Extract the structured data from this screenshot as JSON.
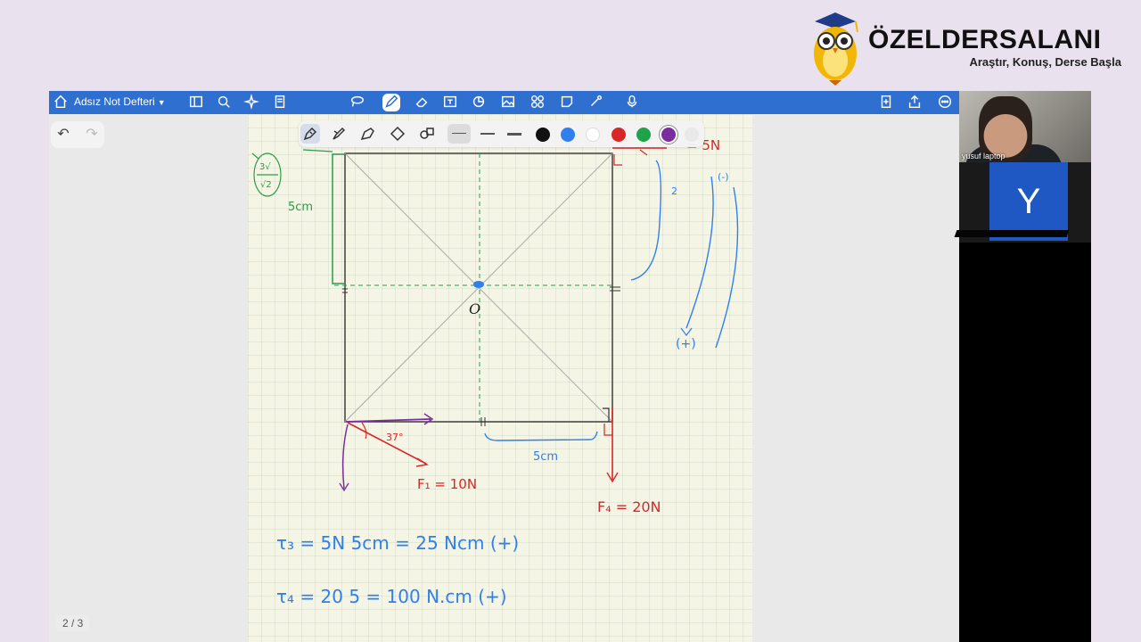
{
  "brand": {
    "name": "ÖZELDERSALANI",
    "tagline": "Araştır, Konuş, Derse Başla"
  },
  "app": {
    "title": "Adsız Not Defteri",
    "page_indicator": "2 / 3"
  },
  "pen_toolbar": {
    "colors": [
      "#111111",
      "#2f80ed",
      "#ffffff",
      "#d62828",
      "#1fa34a",
      "#7b2c9e",
      "#e9e9e9"
    ],
    "selected_color": "#7b2c9e"
  },
  "video": {
    "participant_name": "yusuf laptop",
    "avatar_initial": "Y",
    "avatar_color": "#1f57c3"
  },
  "notes": {
    "point_label": "O",
    "force_f1": "F₁ = 10N",
    "force_f4": "F₄ = 20N",
    "force_f3": "= 5N",
    "angle": "37°",
    "frac_top": "3√",
    "frac_bottom": "√2",
    "len_left": "5cm",
    "len_bottom": "5cm",
    "num_2": "2",
    "minus": "(-)",
    "plus": "(+)",
    "eq1": "τ₃ = 5N  5cm = 25  Ncm  (+)",
    "eq2": "τ₄ = 20 5 = 100 N.cm  (+)"
  }
}
